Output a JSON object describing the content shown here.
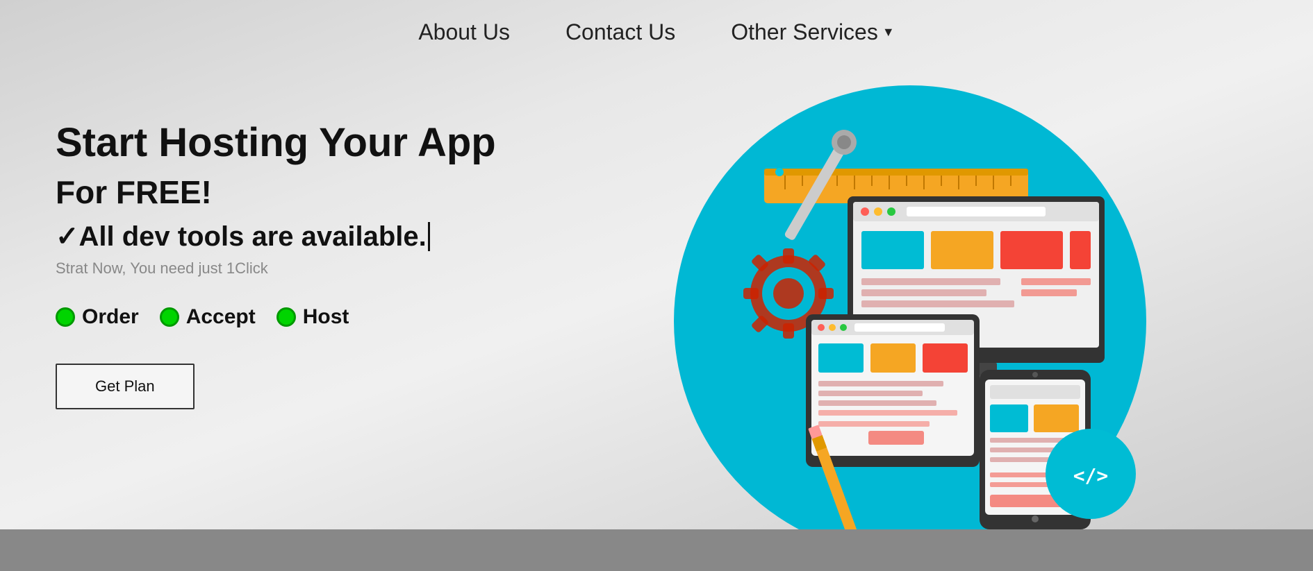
{
  "nav": {
    "about_us": "About Us",
    "contact_us": "Contact Us",
    "other_services": "Other Services",
    "dropdown_arrow": "▼"
  },
  "hero": {
    "title_line1": "Start Hosting Your App",
    "title_line2": "For FREE!",
    "tagline": "✓All dev tools are available.",
    "cta_small": "Strat Now, You need just 1Click",
    "steps": [
      {
        "label": "Order"
      },
      {
        "label": "Accept"
      },
      {
        "label": "Host"
      }
    ],
    "get_plan_label": "Get Plan"
  }
}
